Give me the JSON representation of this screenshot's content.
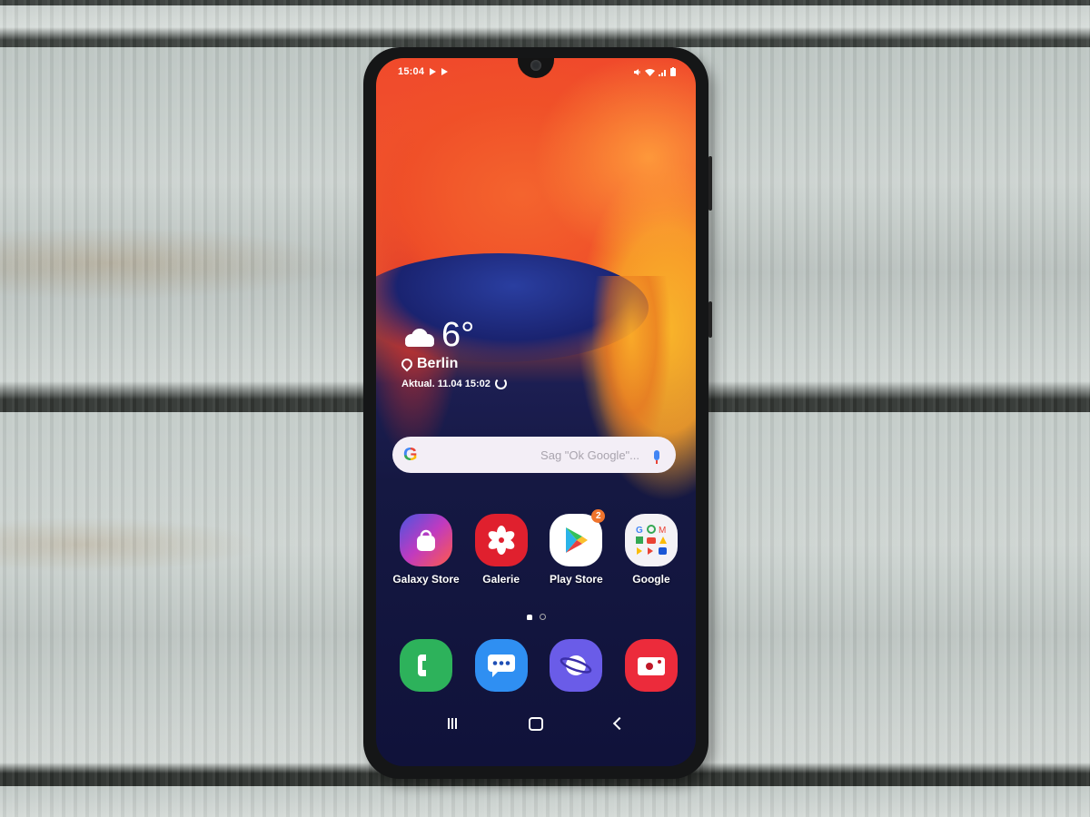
{
  "status_bar": {
    "time": "15:04",
    "left_icons": [
      "play-store-notification-icon",
      "play-store-notification-icon"
    ],
    "right_icons": [
      "mute-icon",
      "wifi-icon",
      "signal-icon",
      "battery-icon"
    ]
  },
  "weather_widget": {
    "icon": "cloud-icon",
    "temperature": "6°",
    "location_icon": "location-pin-icon",
    "location": "Berlin",
    "updated": "Aktual. 11.04 15:02",
    "refresh_icon": "refresh-icon"
  },
  "search_bar": {
    "logo": "G",
    "placeholder": "Sag \"Ok Google\"...",
    "mic_icon": "microphone-icon"
  },
  "home_apps": [
    {
      "label": "Galaxy Store",
      "icon": "galaxy-store-icon",
      "color": "#e8407a"
    },
    {
      "label": "Galerie",
      "icon": "gallery-flower-icon",
      "color": "#e0202e"
    },
    {
      "label": "Play Store",
      "icon": "play-store-icon",
      "color": "#ffffff",
      "badge": "2"
    },
    {
      "label": "Google",
      "icon": "google-folder-icon",
      "color": "#f4f2f6"
    }
  ],
  "page_indicator": {
    "pages": 2,
    "current": "home"
  },
  "dock_apps": [
    {
      "label": "Telefon",
      "icon": "phone-icon",
      "color": "#2db25b"
    },
    {
      "label": "Nachrichten",
      "icon": "messages-icon",
      "color": "#2f8ff2"
    },
    {
      "label": "Internet",
      "icon": "internet-planet-icon",
      "color": "#6a5ce8"
    },
    {
      "label": "Kamera",
      "icon": "camera-icon",
      "color": "#ec2b3b"
    }
  ],
  "nav_bar": {
    "recents": "recent-apps-icon",
    "home": "home-icon",
    "back": "back-icon"
  }
}
